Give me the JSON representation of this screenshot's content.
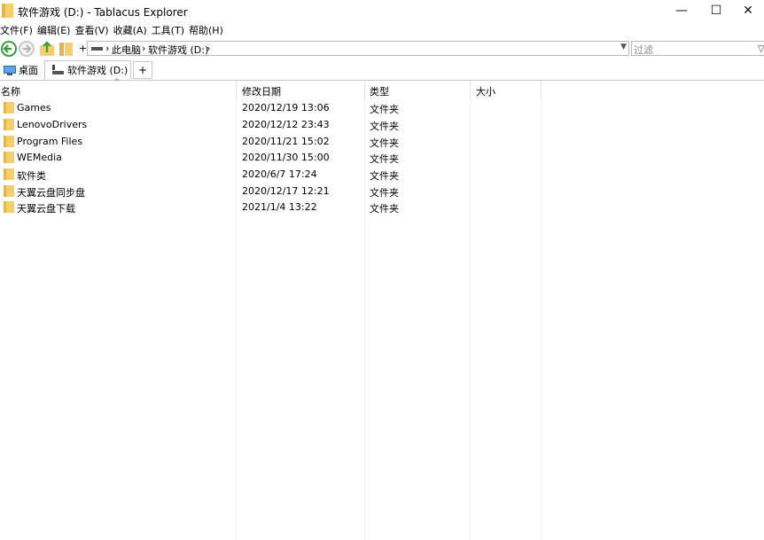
{
  "window": {
    "title": "软件游戏 (D:) - Tablacus Explorer",
    "min_glyph": "—",
    "max_glyph": "☐",
    "close_glyph": "✕"
  },
  "menu": [
    "文件(F)",
    "编辑(E)",
    "查看(V)",
    "收藏(A)",
    "工具(T)",
    "帮助(H)"
  ],
  "address": {
    "crumbs": [
      "此电脑",
      "软件游戏 (D:)"
    ],
    "separator": "›",
    "plus": "+"
  },
  "filter": {
    "placeholder": "过滤"
  },
  "tabs": [
    {
      "label": "桌面"
    },
    {
      "label": "软件游戏 (D:)"
    }
  ],
  "tab_add": "+",
  "columns": [
    "名称",
    "修改日期",
    "类型",
    "大小"
  ],
  "rows": [
    {
      "name": "Games",
      "date": "2020/12/19 13:06",
      "type": "文件夹"
    },
    {
      "name": "LenovoDrivers",
      "date": "2020/12/12 23:43",
      "type": "文件夹"
    },
    {
      "name": "Program Files",
      "date": "2020/11/21 15:02",
      "type": "文件夹"
    },
    {
      "name": "WEMedia",
      "date": "2020/11/30 15:00",
      "type": "文件夹"
    },
    {
      "name": "软件类",
      "date": "2020/6/7 17:24",
      "type": "文件夹"
    },
    {
      "name": "天翼云盘同步盘",
      "date": "2020/12/17 12:21",
      "type": "文件夹"
    },
    {
      "name": "天翼云盘下载",
      "date": "2021/1/4 13:22",
      "type": "文件夹"
    }
  ],
  "colors": {
    "folder": "#f5cf6b",
    "folder_dark": "#e0b54a",
    "nav_green": "#3a9a3a",
    "accent_blue": "#2a6fc4"
  }
}
